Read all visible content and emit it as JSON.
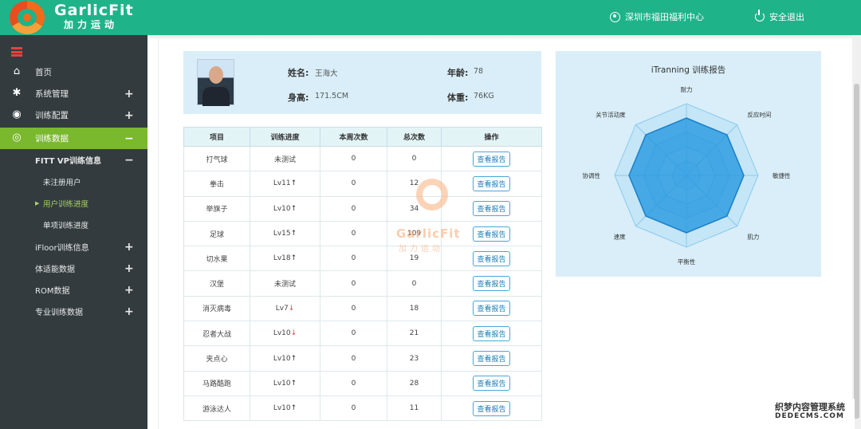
{
  "header": {
    "logo_text": "GarlicFit",
    "logo_sub": "加力运动",
    "location": "深圳市福田福利中心",
    "logout": "安全退出",
    "icons": [
      "user-circle-icon",
      "power-icon"
    ]
  },
  "sidebar": {
    "items": [
      {
        "label": "首页",
        "icon": "home-icon"
      },
      {
        "label": "系统管理",
        "icon": "gear-icon",
        "toggle": "+"
      },
      {
        "label": "训练配置",
        "icon": "dumbbell-icon",
        "toggle": "+"
      },
      {
        "label": "训练数据",
        "icon": "data-icon",
        "toggle": "−"
      }
    ],
    "sub_items": [
      {
        "label": "FITT VP训练信息",
        "toggle": "−"
      },
      {
        "label": "未注册用户"
      },
      {
        "label": "用户训练进度"
      },
      {
        "label": "单项训练进度"
      },
      {
        "label": "iFloor训练信息",
        "toggle": "+"
      },
      {
        "label": "体适能数据",
        "toggle": "+"
      },
      {
        "label": "ROM数据",
        "toggle": "+"
      },
      {
        "label": "专业训练数据",
        "toggle": "+"
      }
    ]
  },
  "profile": {
    "name_label": "姓名:",
    "name": "王海大",
    "age_label": "年龄:",
    "age": "78",
    "height_label": "身高:",
    "height": "171.5CM",
    "weight_label": "体重:",
    "weight": "76KG"
  },
  "table": {
    "headers": [
      "项目",
      "训练进度",
      "本周次数",
      "总次数",
      "操作"
    ],
    "button_label": "查看报告",
    "rows": [
      {
        "item": "打气球",
        "progress": "未测试",
        "arrow": "",
        "week": "0",
        "total": "0"
      },
      {
        "item": "拳击",
        "progress": "Lv11",
        "arrow": "↑",
        "week": "0",
        "total": "12"
      },
      {
        "item": "举旗子",
        "progress": "Lv10",
        "arrow": "↑",
        "week": "0",
        "total": "34"
      },
      {
        "item": "足球",
        "progress": "Lv15",
        "arrow": "↑",
        "week": "0",
        "total": "109"
      },
      {
        "item": "切水果",
        "progress": "Lv18",
        "arrow": "↑",
        "week": "0",
        "total": "19"
      },
      {
        "item": "汉堡",
        "progress": "未测试",
        "arrow": "",
        "week": "0",
        "total": "0"
      },
      {
        "item": "消灭病毒",
        "progress": "Lv7",
        "arrow": "↓",
        "week": "0",
        "total": "18"
      },
      {
        "item": "忍者大战",
        "progress": "Lv10",
        "arrow": "↓",
        "week": "0",
        "total": "21"
      },
      {
        "item": "夹点心",
        "progress": "Lv10",
        "arrow": "↑",
        "week": "0",
        "total": "23"
      },
      {
        "item": "马路酷跑",
        "progress": "Lv10",
        "arrow": "↑",
        "week": "0",
        "total": "28"
      },
      {
        "item": "游泳达人",
        "progress": "Lv10",
        "arrow": "↑",
        "week": "0",
        "total": "11"
      }
    ]
  },
  "watermark": {
    "en": "GarlicFit",
    "cn": "加力运动"
  },
  "chart_data": {
    "type": "radar",
    "title": "iTranning 训练报告",
    "axes": [
      "耐力",
      "反应时间",
      "敏捷性",
      "肌力",
      "平衡性",
      "速度",
      "协调性",
      "关节活动度"
    ],
    "values": [
      0.8,
      0.8,
      0.8,
      0.8,
      0.8,
      0.8,
      0.8,
      0.8
    ],
    "range": [
      0,
      1
    ],
    "colors": {
      "fill": "#2b9be0",
      "stroke": "#1a7fc8",
      "grid": "#8cc9ec"
    }
  },
  "site_watermark": {
    "line1": "织梦内容管理系统",
    "line2": "DEDECMS.COM"
  }
}
